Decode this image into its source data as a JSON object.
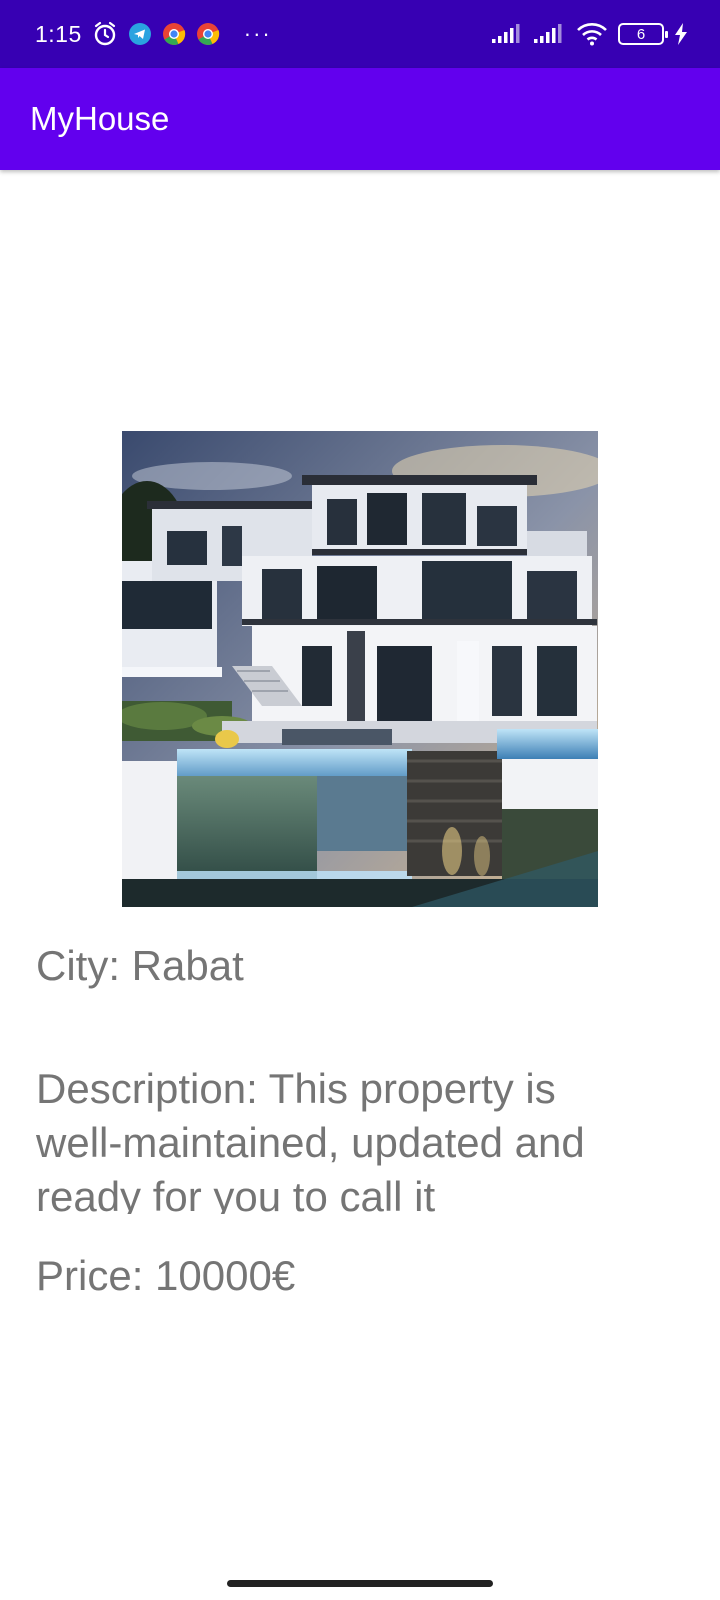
{
  "status_bar": {
    "time": "1:15",
    "battery_level": "6",
    "left_icons": [
      "alarm-icon",
      "telegram-icon",
      "chrome-icon",
      "chrome-icon"
    ],
    "more_indicator": "···",
    "right_icons": [
      "signal-icon",
      "signal-icon",
      "wifi-icon",
      "battery-icon",
      "charging-icon"
    ]
  },
  "app_bar": {
    "title": "MyHouse"
  },
  "listing": {
    "city_text": "City: Rabat",
    "description_text": "Description: This property is well-maintained, updated and ready for you to call it",
    "price_text": "Price: 10000€"
  },
  "colors": {
    "status_bar": "#3700b3",
    "app_bar": "#6200ee",
    "body_text": "#757575"
  }
}
